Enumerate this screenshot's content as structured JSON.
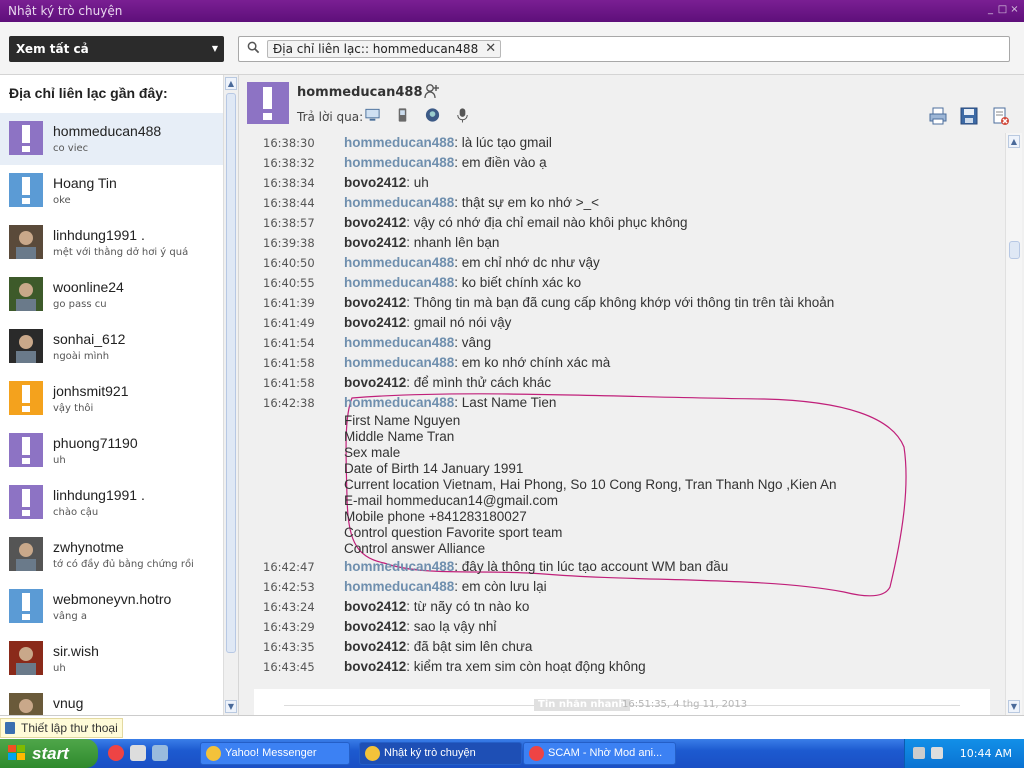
{
  "window": {
    "title": "Nhật ký trò chuyện",
    "controls": [
      "_",
      "□",
      "×"
    ]
  },
  "toolbar": {
    "filter_label": "Xem tất cả",
    "search_chip": "Địa chỉ liên lạc:: hommeducan488"
  },
  "sidebar": {
    "heading": "Địa chỉ liên lạc gần đây:",
    "contacts": [
      {
        "name": "hommeducan488",
        "status": "co viec",
        "avatar": "default-purple"
      },
      {
        "name": "Hoang Tin",
        "status": "oke",
        "avatar": "default-blue"
      },
      {
        "name": "linhdung1991 .",
        "status": "mệt với thằng dở hơi ý quá",
        "avatar": "photo"
      },
      {
        "name": "woonline24",
        "status": "go pass cu",
        "avatar": "photo"
      },
      {
        "name": "sonhai_612",
        "status": "ngoài mình",
        "avatar": "photo"
      },
      {
        "name": "jonhsmit921",
        "status": "vậy thôi",
        "avatar": "default-orange"
      },
      {
        "name": "phuong71190",
        "status": "uh",
        "avatar": "default-purple"
      },
      {
        "name": "linhdung1991 .",
        "status": "chào cậu",
        "avatar": "default-purple"
      },
      {
        "name": "zwhynotme",
        "status": "tớ có đầy đủ bằng chứng rồi",
        "avatar": "photo"
      },
      {
        "name": "webmoneyvn.hotro",
        "status": "vâng a",
        "avatar": "default-blue"
      },
      {
        "name": "sir.wish",
        "status": "uh",
        "avatar": "photo"
      },
      {
        "name": "vnug",
        "status": "",
        "avatar": "photo"
      }
    ]
  },
  "chat": {
    "contact_name": "hommeducan488",
    "reply_label": "Trả lời qua:",
    "reply_icons": [
      "computer-icon",
      "mobile-icon",
      "messenger-icon",
      "microphone-icon"
    ],
    "action_icons": [
      "print-icon",
      "save-icon",
      "delete-icon"
    ],
    "messages": [
      {
        "time": "16:38:30",
        "from": "hommeducan488",
        "who": "them",
        "text": ": là lúc tạo gmail"
      },
      {
        "time": "16:38:32",
        "from": "hommeducan488",
        "who": "them",
        "text": ": em điền vào ạ"
      },
      {
        "time": "16:38:34",
        "from": "bovo2412",
        "who": "me",
        "text": ": uh"
      },
      {
        "time": "16:38:44",
        "from": "hommeducan488",
        "who": "them",
        "text": ": thật sự em ko nhớ >_<"
      },
      {
        "time": "16:38:57",
        "from": "bovo2412",
        "who": "me",
        "text": ": vậy có nhớ địa chỉ email nào khôi phục không"
      },
      {
        "time": "16:39:38",
        "from": "bovo2412",
        "who": "me",
        "text": ": nhanh lên bạn"
      },
      {
        "time": "16:40:50",
        "from": "hommeducan488",
        "who": "them",
        "text": ": em chỉ nhớ dc như vậy"
      },
      {
        "time": "16:40:55",
        "from": "hommeducan488",
        "who": "them",
        "text": ": ko biết chính xác ko"
      },
      {
        "time": "16:41:39",
        "from": "bovo2412",
        "who": "me",
        "text": ": Thông tin mà bạn đã cung cấp không khớp với thông tin trên tài khoản"
      },
      {
        "time": "16:41:49",
        "from": "bovo2412",
        "who": "me",
        "text": ": gmail nó nói vậy"
      },
      {
        "time": "16:41:54",
        "from": "hommeducan488",
        "who": "them",
        "text": ": vâng"
      },
      {
        "time": "16:41:58",
        "from": "hommeducan488",
        "who": "them",
        "text": ": em ko nhớ chính xác mà"
      },
      {
        "time": "16:41:58",
        "from": "bovo2412",
        "who": "me",
        "text": ": để mình thử cách khác"
      },
      {
        "time": "16:42:38",
        "from": "hommeducan488",
        "who": "them",
        "text": ": Last Name Tien",
        "continuation": [
          "First Name Nguyen",
          "Middle Name Tran",
          "Sex male",
          "Date of Birth 14 January 1991",
          "Current location Vietnam, Hai Phong, So 10 Cong Rong, Tran Thanh Ngo ,Kien An",
          "E-mail hommeducan14@gmail.com",
          "Mobile phone +841283180027",
          "Control question Favorite sport team",
          "Control answer Alliance"
        ]
      },
      {
        "time": "16:42:47",
        "from": "hommeducan488",
        "who": "them",
        "text": ": đây là thông tin lúc tạo account WM ban đầu"
      },
      {
        "time": "16:42:53",
        "from": "hommeducan488",
        "who": "them",
        "text": ": em còn lưu lại"
      },
      {
        "time": "16:43:24",
        "from": "bovo2412",
        "who": "me",
        "text": ": từ nãy có tn nào ko"
      },
      {
        "time": "16:43:29",
        "from": "bovo2412",
        "who": "me",
        "text": ": sao lạ vậy nhỉ"
      },
      {
        "time": "16:43:35",
        "from": "bovo2412",
        "who": "me",
        "text": ": đã bật sim lên chưa"
      },
      {
        "time": "16:43:45",
        "from": "bovo2412",
        "who": "me",
        "text": ": kiểm tra xem sim còn hoạt động không"
      }
    ],
    "footer_badge": "Tin nhắn nhanh",
    "footer_time": "16:51:35, 4 thg 11, 2013"
  },
  "statusbar": {
    "phone_label": "Thiết lập thư thoại"
  },
  "taskbar": {
    "start_label": "start",
    "tasks": [
      {
        "label": "Yahoo! Messenger",
        "active": false
      },
      {
        "label": "Nhật ký trò chuyện",
        "active": true
      },
      {
        "label": "SCAM - Nhờ Mod ani...",
        "active": false
      }
    ],
    "clock": "10:44 AM"
  },
  "colors": {
    "title_bar": "#6a168a",
    "them_name": "#6f8fae",
    "me_name": "#333333",
    "selected_row": "#e7eef7",
    "annotation": "#c0207a"
  }
}
